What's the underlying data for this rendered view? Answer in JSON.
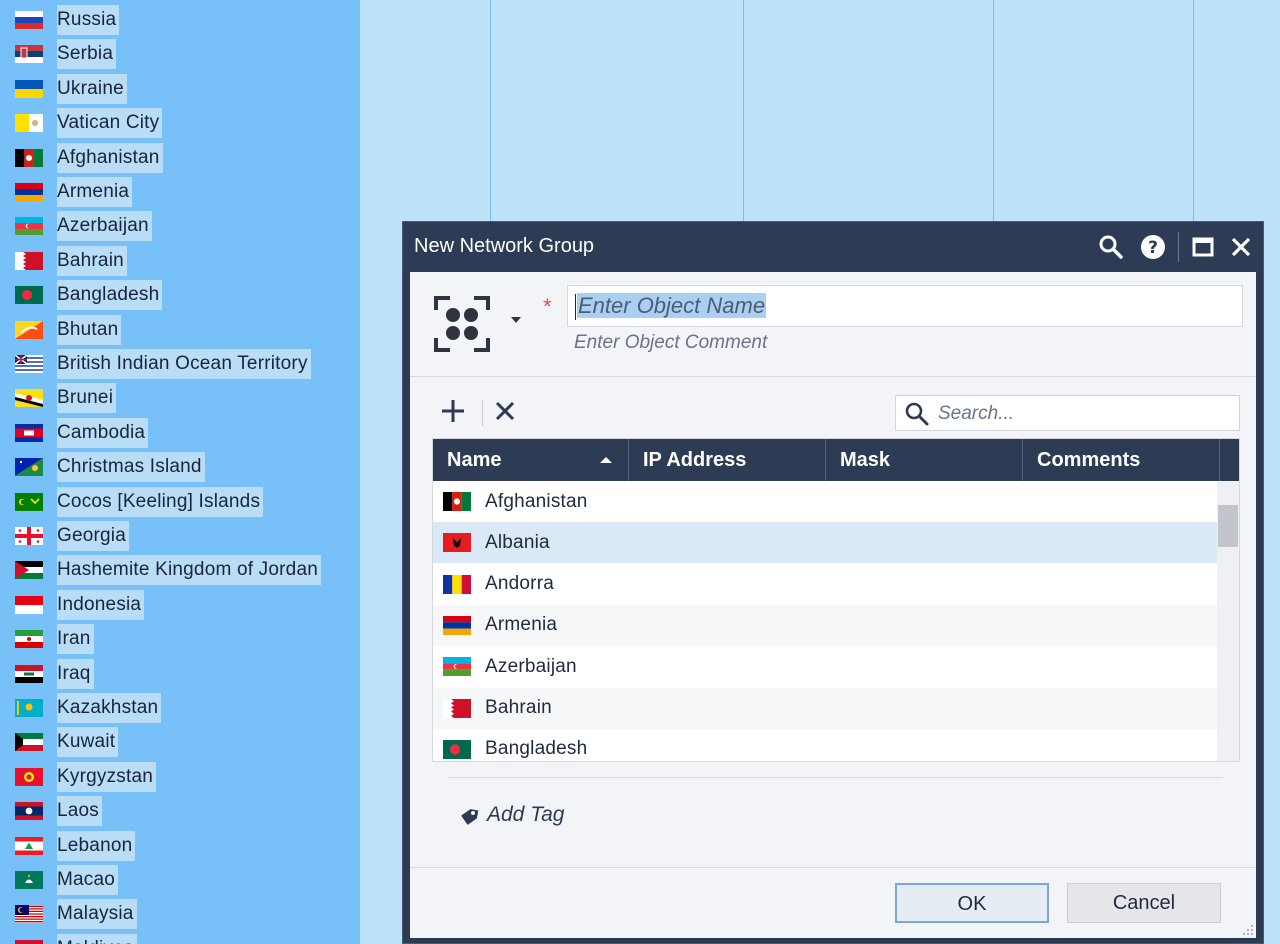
{
  "left_list": {
    "countries": [
      {
        "name": "Russia",
        "flag": "russia-flag"
      },
      {
        "name": "Serbia",
        "flag": "serbia-flag"
      },
      {
        "name": "Ukraine",
        "flag": "ukraine-flag"
      },
      {
        "name": "Vatican City",
        "flag": "vatican-flag"
      },
      {
        "name": "Afghanistan",
        "flag": "afghanistan-flag"
      },
      {
        "name": "Armenia",
        "flag": "armenia-flag"
      },
      {
        "name": "Azerbaijan",
        "flag": "azerbaijan-flag"
      },
      {
        "name": "Bahrain",
        "flag": "bahrain-flag"
      },
      {
        "name": "Bangladesh",
        "flag": "bangladesh-flag"
      },
      {
        "name": "Bhutan",
        "flag": "bhutan-flag"
      },
      {
        "name": "British Indian Ocean Territory",
        "flag": "biot-flag"
      },
      {
        "name": "Brunei",
        "flag": "brunei-flag"
      },
      {
        "name": "Cambodia",
        "flag": "cambodia-flag"
      },
      {
        "name": "Christmas Island",
        "flag": "christmas-island-flag"
      },
      {
        "name": "Cocos [Keeling] Islands",
        "flag": "cocos-flag"
      },
      {
        "name": "Georgia",
        "flag": "georgia-flag"
      },
      {
        "name": "Hashemite Kingdom of Jordan",
        "flag": "jordan-flag"
      },
      {
        "name": "Indonesia",
        "flag": "indonesia-flag"
      },
      {
        "name": "Iran",
        "flag": "iran-flag"
      },
      {
        "name": "Iraq",
        "flag": "iraq-flag"
      },
      {
        "name": "Kazakhstan",
        "flag": "kazakhstan-flag"
      },
      {
        "name": "Kuwait",
        "flag": "kuwait-flag"
      },
      {
        "name": "Kyrgyzstan",
        "flag": "kyrgyzstan-flag"
      },
      {
        "name": "Laos",
        "flag": "laos-flag"
      },
      {
        "name": "Lebanon",
        "flag": "lebanon-flag"
      },
      {
        "name": "Macao",
        "flag": "macao-flag"
      },
      {
        "name": "Malaysia",
        "flag": "malaysia-flag"
      },
      {
        "name": "Maldives",
        "flag": "maldives-flag"
      }
    ]
  },
  "dialog": {
    "title": "New Network Group",
    "title_icons": [
      "search-icon",
      "help-icon",
      "maximize-icon",
      "close-icon"
    ],
    "object_icon": "network-group-icon",
    "required_mark": "*",
    "name_placeholder": "Enter Object Name",
    "comment_placeholder": "Enter Object Comment",
    "toolbar": {
      "add_icon": "plus-icon",
      "remove_icon": "x-icon"
    },
    "search_placeholder": "Search...",
    "grid": {
      "columns": [
        "Name",
        "IP Address",
        "Mask",
        "Comments"
      ],
      "sort_column": "Name",
      "sort_direction": "ascending",
      "rows": [
        {
          "name": "Afghanistan",
          "flag": "afghanistan-flag",
          "ip": "",
          "mask": "",
          "comments": ""
        },
        {
          "name": "Albania",
          "flag": "albania-flag",
          "ip": "",
          "mask": "",
          "comments": ""
        },
        {
          "name": "Andorra",
          "flag": "andorra-flag",
          "ip": "",
          "mask": "",
          "comments": ""
        },
        {
          "name": "Armenia",
          "flag": "armenia-flag",
          "ip": "",
          "mask": "",
          "comments": ""
        },
        {
          "name": "Azerbaijan",
          "flag": "azerbaijan-flag",
          "ip": "",
          "mask": "",
          "comments": ""
        },
        {
          "name": "Bahrain",
          "flag": "bahrain-flag",
          "ip": "",
          "mask": "",
          "comments": ""
        },
        {
          "name": "Bangladesh",
          "flag": "bangladesh-flag",
          "ip": "",
          "mask": "",
          "comments": ""
        }
      ]
    },
    "add_tag_label": "Add Tag",
    "ok_label": "OK",
    "cancel_label": "Cancel"
  },
  "colors": {
    "left_panel": "#78c0f8",
    "dialog_header": "#2e3b54",
    "background": "#bfe2fb"
  }
}
